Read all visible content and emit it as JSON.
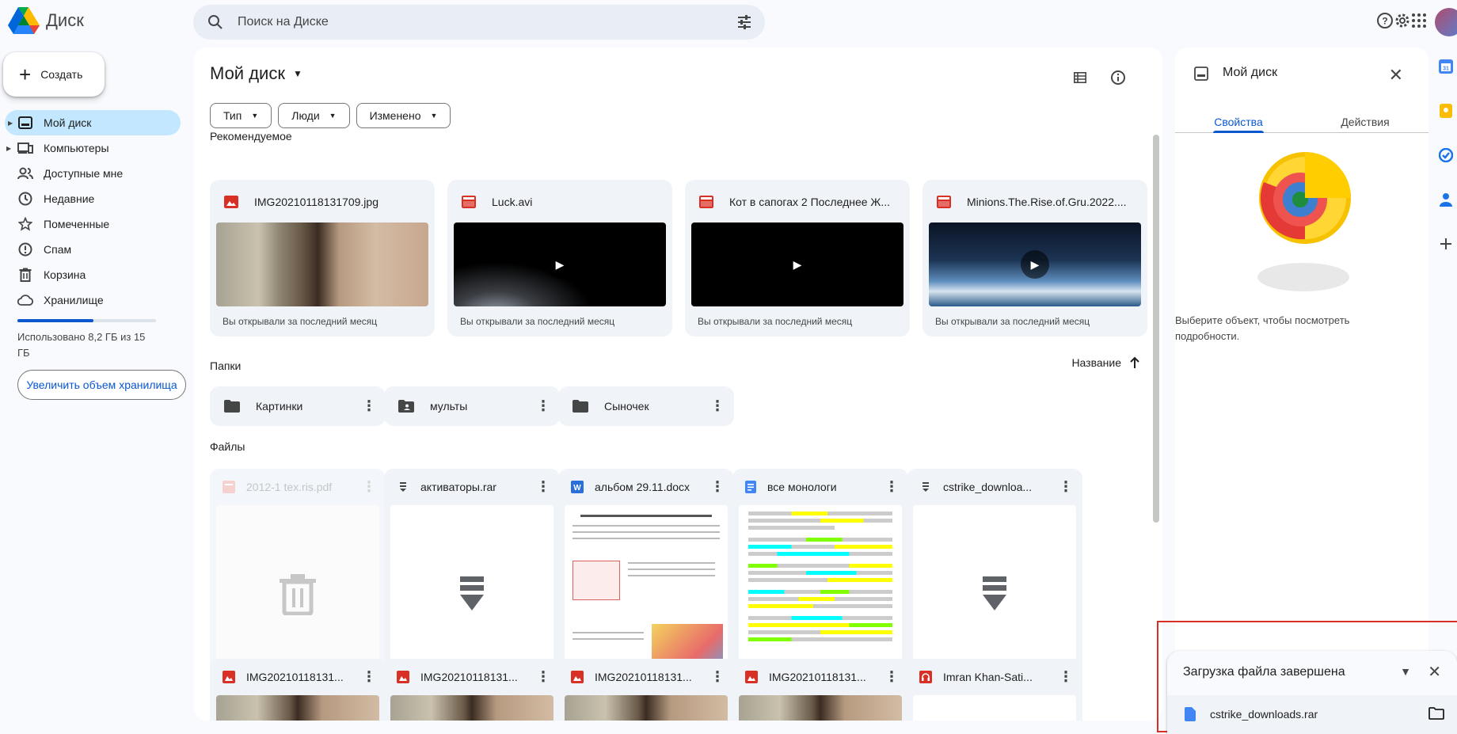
{
  "app": {
    "title": "Диск"
  },
  "search": {
    "placeholder": "Поиск на Диске"
  },
  "sidebar": {
    "new_label": "Создать",
    "items": [
      {
        "label": "Мой диск",
        "icon": "my-drive-icon"
      },
      {
        "label": "Компьютеры",
        "icon": "computers-icon"
      },
      {
        "label": "Доступные мне",
        "icon": "shared-icon"
      },
      {
        "label": "Недавние",
        "icon": "clock-icon"
      },
      {
        "label": "Помеченные",
        "icon": "star-icon"
      },
      {
        "label": "Спам",
        "icon": "spam-icon"
      },
      {
        "label": "Корзина",
        "icon": "trash-icon"
      },
      {
        "label": "Хранилище",
        "icon": "cloud-icon"
      }
    ],
    "storage_used_fraction": 0.55,
    "storage_text": "Использовано 8,2 ГБ из 15 ГБ",
    "upgrade_label": "Увеличить объем хранилища"
  },
  "main": {
    "title": "Мой диск",
    "filters": [
      "Тип",
      "Люди",
      "Изменено"
    ],
    "suggested_label": "Рекомендуемое",
    "suggested": [
      {
        "name": "IMG20210118131709.jpg",
        "meta": "Вы открывали за последний месяц",
        "kind": "image"
      },
      {
        "name": "Luck.avi",
        "meta": "Вы открывали за последний месяц",
        "kind": "video"
      },
      {
        "name": "Кот в сапогах 2 Последнее Ж...",
        "meta": "Вы открывали за последний месяц",
        "kind": "video"
      },
      {
        "name": "Minions.The.Rise.of.Gru.2022....",
        "meta": "Вы открывали за последний месяц",
        "kind": "video"
      }
    ],
    "folders_label": "Папки",
    "sort_label": "Название",
    "folders": [
      {
        "name": "Картинки"
      },
      {
        "name": "мульты"
      },
      {
        "name": "Сыночек"
      }
    ],
    "files_label": "Файлы",
    "files_row1": [
      {
        "name": "2012-1 tex.ris.pdf"
      },
      {
        "name": "активаторы.rar"
      },
      {
        "name": "альбом 29.11.docx"
      },
      {
        "name": "все монологи"
      },
      {
        "name": "cstrike_downloa..."
      }
    ],
    "files_row2": [
      {
        "name": "IMG20210118131..."
      },
      {
        "name": "IMG20210118131..."
      },
      {
        "name": "IMG20210118131..."
      },
      {
        "name": "IMG20210118131..."
      },
      {
        "name": "Imran Khan-Sati..."
      }
    ]
  },
  "details": {
    "title": "Мой диск",
    "tabs": [
      "Свойства",
      "Действия"
    ],
    "hint": "Выберите объект, чтобы посмотреть подробности."
  },
  "toast": {
    "title": "Загрузка файла завершена",
    "file": "cstrike_downloads.rar"
  },
  "colors": {
    "accent": "#0b57d0",
    "active_nav": "#c2e7ff",
    "highlight_frame": "#d93025"
  }
}
